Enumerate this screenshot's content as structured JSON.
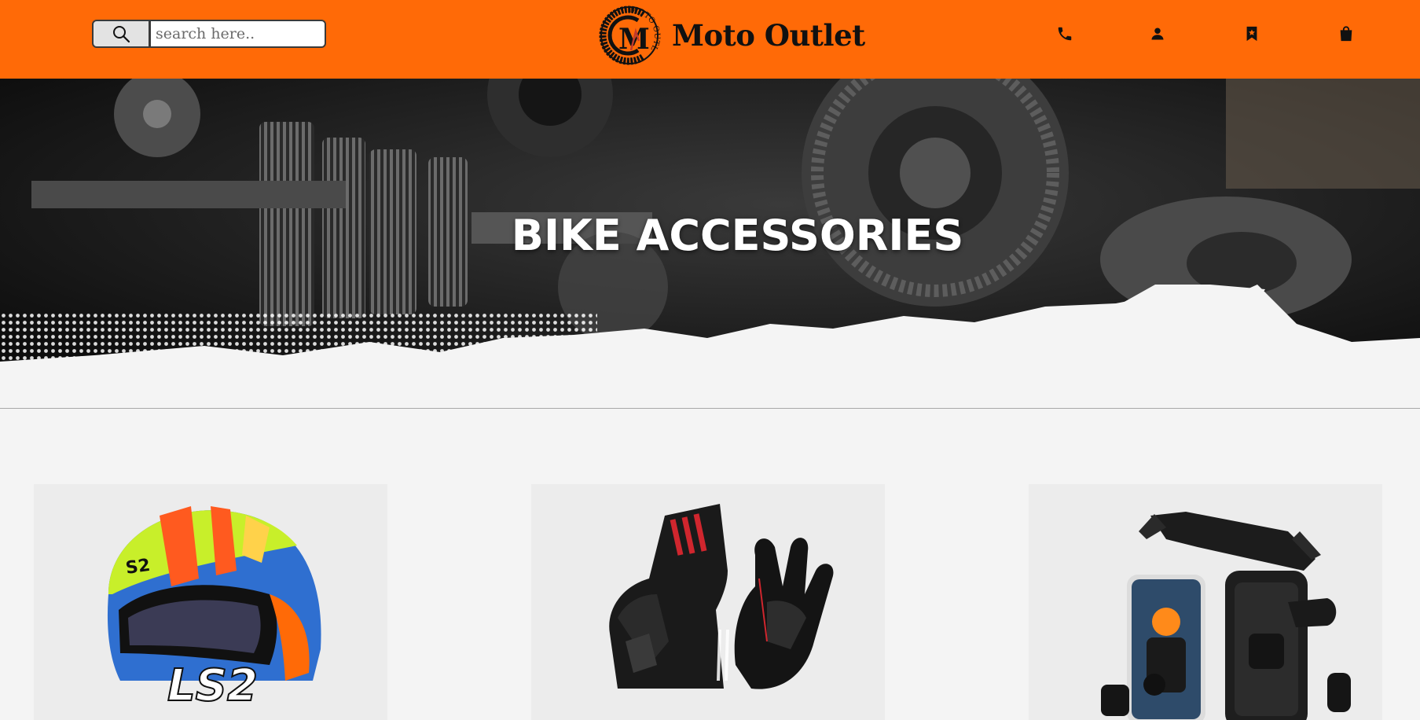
{
  "header": {
    "brand_name": "Moto Outlet",
    "logo_text": "MOTO OUTLET",
    "logo_letter": "M",
    "search": {
      "placeholder": "search here..",
      "value": ""
    },
    "icons": [
      "search-icon",
      "phone-icon",
      "user-icon",
      "bookmark-icon",
      "shopping-bag-icon"
    ],
    "accent_color": "#ff6a07"
  },
  "hero": {
    "title": "BIKE ACCESSORIES"
  },
  "products": [
    {
      "name": "helmet",
      "logo_text": "LS2",
      "logo_text_small": "S2"
    },
    {
      "name": "gloves"
    },
    {
      "name": "phone-holder"
    }
  ]
}
